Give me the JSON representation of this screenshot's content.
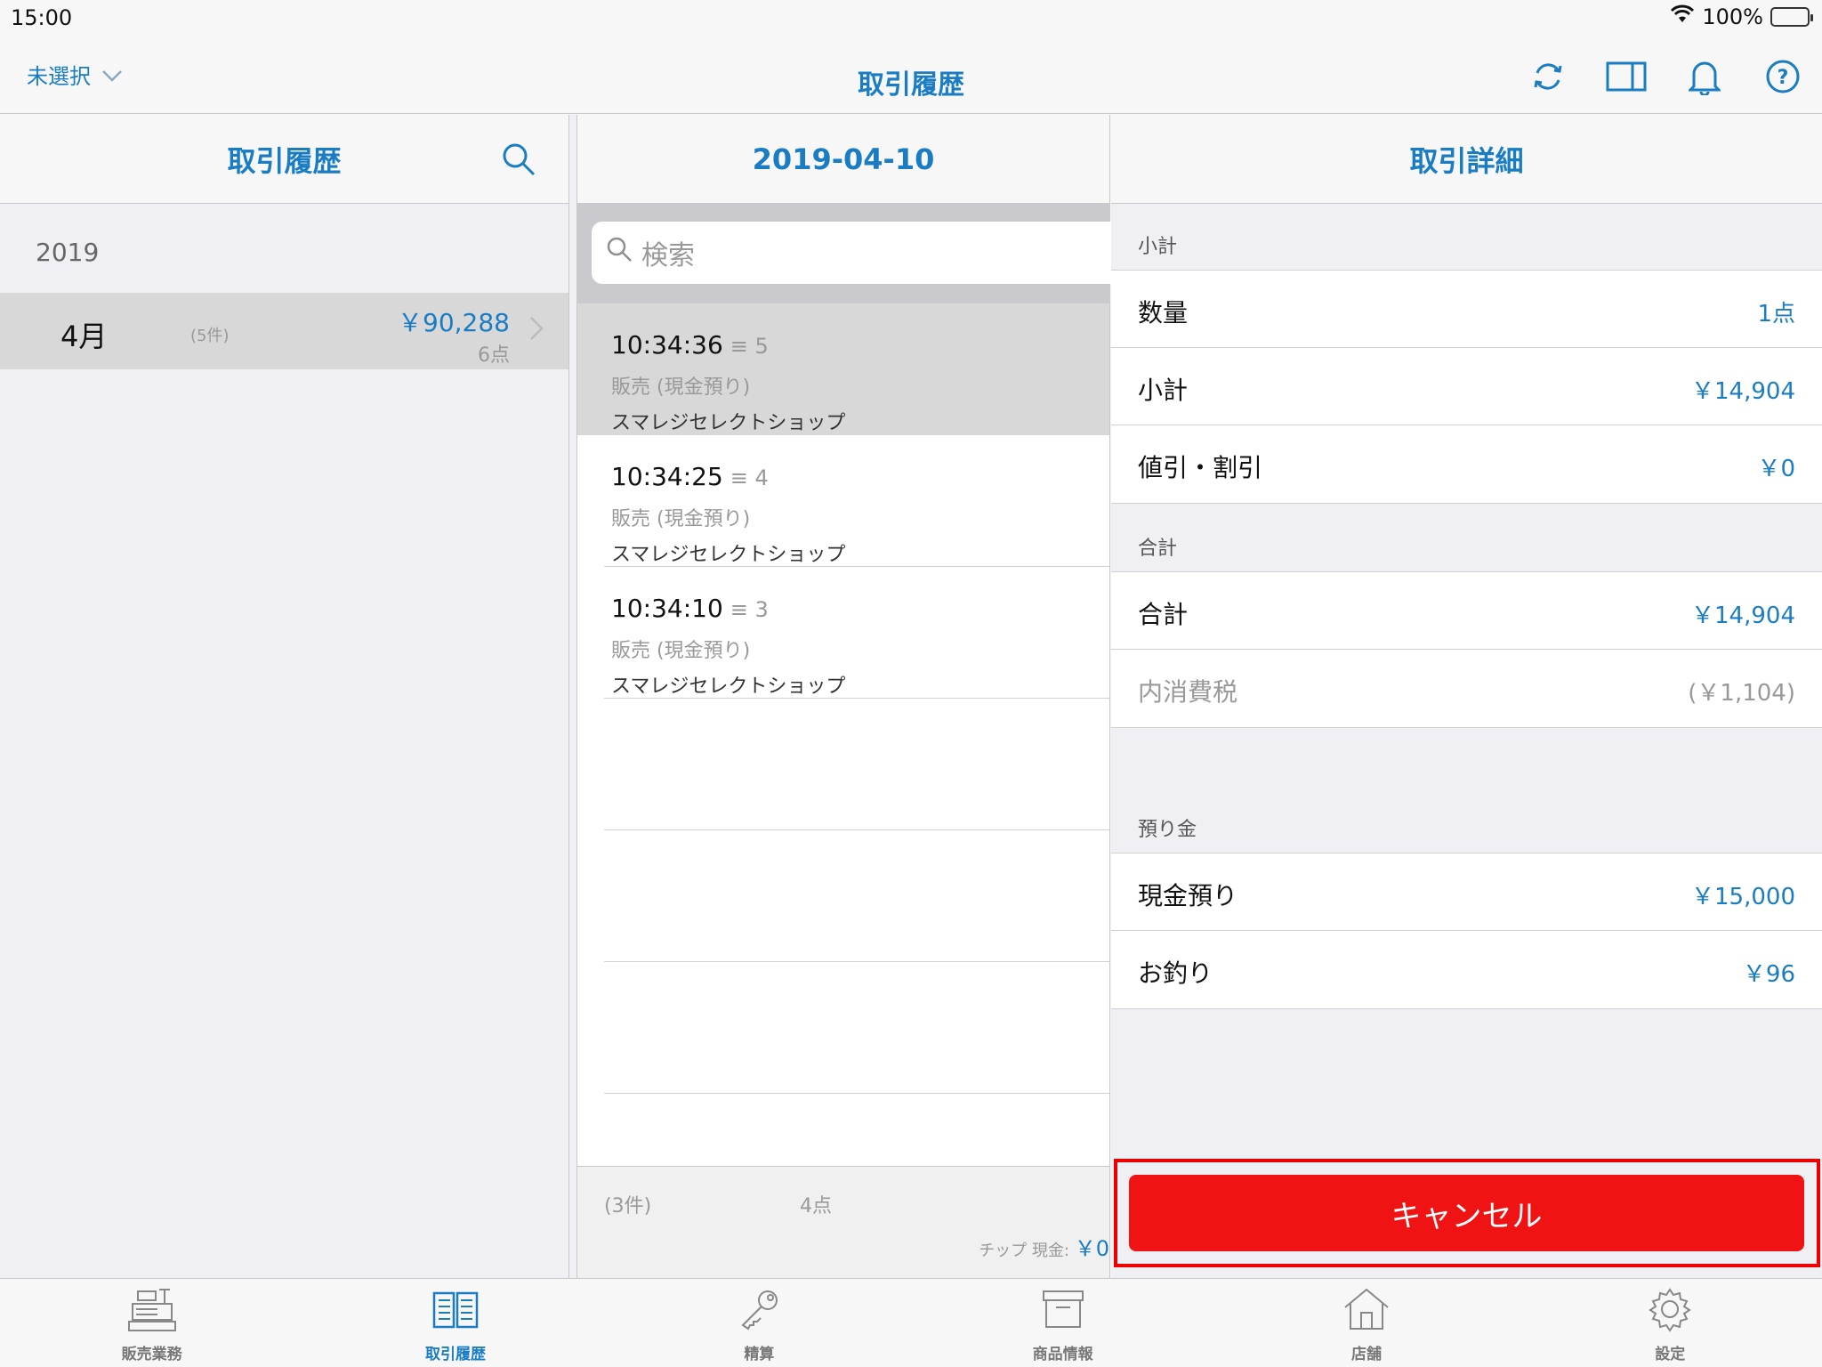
{
  "status": {
    "time": "15:00",
    "battery": "100%"
  },
  "nav": {
    "left_label": "未選択",
    "title": "取引履歴"
  },
  "col1": {
    "header": "取引履歴",
    "year": "2019",
    "months": [
      {
        "month": "4月",
        "count": "(5件)",
        "amount": "￥90,288",
        "points": "6点"
      }
    ]
  },
  "col2": {
    "header": "2019-04-10",
    "search_placeholder": "検索",
    "transactions": [
      {
        "time": "10:34:36",
        "qty": "≡ 5",
        "type": "販売 (現金預り)",
        "shop": "スマレジセレクトショップ"
      },
      {
        "time": "10:34:25",
        "qty": "≡ 4",
        "type": "販売 (現金預り)",
        "shop": "スマレジセレクトショップ"
      },
      {
        "time": "10:34:10",
        "qty": "≡ 3",
        "type": "販売 (現金預り)",
        "shop": "スマレジセレクトショップ"
      }
    ],
    "footer": {
      "count": "(3件)",
      "points": "4点",
      "tip_label": "チップ 現金:",
      "tip_value": "￥0"
    }
  },
  "col3": {
    "header": "取引詳細",
    "subtotal_section": "小計",
    "subtotal_rows": [
      {
        "label": "数量",
        "value": "1点"
      },
      {
        "label": "小計",
        "value": "￥14,904"
      },
      {
        "label": "値引・割引",
        "value": "￥0"
      }
    ],
    "total_section": "合計",
    "total_rows": [
      {
        "label": "合計",
        "value": "￥14,904"
      },
      {
        "label": "内消費税",
        "value": "(￥1,104)"
      }
    ],
    "deposit_section": "預り金",
    "deposit_rows": [
      {
        "label": "現金預り",
        "value": "￥15,000"
      },
      {
        "label": "お釣り",
        "value": "￥96"
      }
    ],
    "cancel_label": "キャンセル"
  },
  "tabs": [
    {
      "label": "販売業務",
      "icon": "register-icon"
    },
    {
      "label": "取引履歴",
      "icon": "book-icon"
    },
    {
      "label": "精算",
      "icon": "key-icon"
    },
    {
      "label": "商品情報",
      "icon": "box-icon"
    },
    {
      "label": "店舗",
      "icon": "store-icon"
    },
    {
      "label": "設定",
      "icon": "gear-icon"
    }
  ],
  "colors": {
    "accent": "#1a7dc4",
    "cancel": "#ef1313",
    "highlight_border": "#e00000"
  }
}
